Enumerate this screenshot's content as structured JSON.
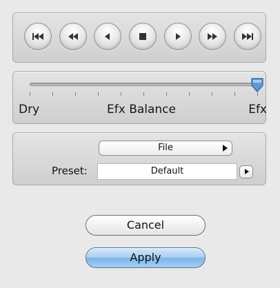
{
  "transport": {
    "buttons": [
      {
        "name": "skip-to-start",
        "icon": "skip-to-start-icon"
      },
      {
        "name": "rewind",
        "icon": "rewind-icon"
      },
      {
        "name": "step-back",
        "icon": "step-back-icon"
      },
      {
        "name": "stop",
        "icon": "stop-icon"
      },
      {
        "name": "play",
        "icon": "play-icon"
      },
      {
        "name": "fast-forward",
        "icon": "fast-forward-icon"
      },
      {
        "name": "skip-to-end",
        "icon": "skip-to-end-icon"
      }
    ]
  },
  "balance": {
    "left_label": "Dry",
    "center_label": "Efx Balance",
    "right_label": "Efx",
    "value": 1.0,
    "tick_count": 11
  },
  "preset": {
    "file_label": "File",
    "label": "Preset:",
    "value": "Default"
  },
  "actions": {
    "cancel_label": "Cancel",
    "apply_label": "Apply"
  },
  "colors": {
    "apply_blue": "#8cc0ec",
    "thumb_blue": "#5f98d6",
    "panel_bg": "#d8d8d8"
  }
}
